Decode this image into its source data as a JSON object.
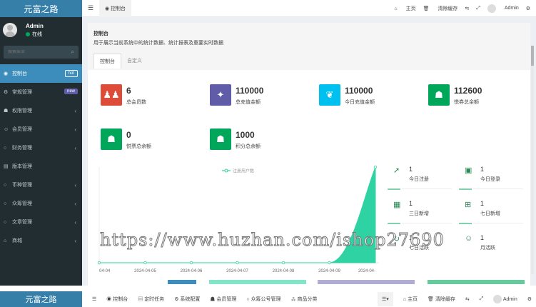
{
  "app": {
    "logo": "元富之路"
  },
  "user": {
    "name": "Admin",
    "status": "在线"
  },
  "search": {
    "placeholder": "搜索菜单"
  },
  "sidebar": {
    "items": [
      {
        "icon": "dashboard-icon",
        "glyph": "◉",
        "label": "控制台",
        "badge": "hot"
      },
      {
        "icon": "cogs-icon",
        "glyph": "⚙",
        "label": "常规管理",
        "badge": "new"
      },
      {
        "icon": "users-icon",
        "glyph": "☗",
        "label": "权限管理"
      },
      {
        "icon": "user-icon",
        "glyph": "☺",
        "label": "会员管理"
      },
      {
        "icon": "circle-icon",
        "glyph": "○",
        "label": "财务管理"
      },
      {
        "icon": "file-icon",
        "glyph": "▤",
        "label": "版本管理"
      },
      {
        "icon": "circle-icon",
        "glyph": "○",
        "label": "币种管理"
      },
      {
        "icon": "circle-icon",
        "glyph": "○",
        "label": "众筹管理"
      },
      {
        "icon": "circle-icon",
        "glyph": "○",
        "label": "文章管理"
      },
      {
        "icon": "shop-icon",
        "glyph": "⌂",
        "label": "商城"
      }
    ]
  },
  "topbar": {
    "tab": "控制台",
    "home": "主页",
    "clear_cache": "清除缓存",
    "admin": "Admin"
  },
  "panel": {
    "title": "控制台",
    "desc": "用于展示当前系统中的统计数据、统计报表及重要实时数据",
    "tabs": [
      "控制台",
      "自定义"
    ]
  },
  "stats": [
    {
      "value": "6",
      "label": "总会员数",
      "color": "#dd4b39",
      "icon": "users-icon",
      "glyph": "👥"
    },
    {
      "value": "110000",
      "label": "总充值金额",
      "color": "#605ca8",
      "icon": "magic-icon",
      "glyph": "✦"
    },
    {
      "value": "110000",
      "label": "今日充值金额",
      "color": "#00c0ef",
      "icon": "leaf-icon",
      "glyph": "❦"
    },
    {
      "value": "112600",
      "label": "悦券总余额",
      "color": "#00a65a",
      "icon": "user-icon",
      "glyph": "☗"
    },
    {
      "value": "0",
      "label": "悦票总余额",
      "color": "#00a65a",
      "icon": "user-icon",
      "glyph": "☗"
    },
    {
      "value": "1000",
      "label": "积分总余额",
      "color": "#00a65a",
      "icon": "user-icon",
      "glyph": "☗"
    }
  ],
  "right_stats": [
    {
      "value": "1",
      "label": "今日注册",
      "icon": "rocket-icon",
      "glyph": "➚"
    },
    {
      "value": "1",
      "label": "今日登录",
      "icon": "vcard-icon",
      "glyph": "▣"
    },
    {
      "value": "1",
      "label": "三日新增",
      "icon": "calendar-icon",
      "glyph": "▦"
    },
    {
      "value": "1",
      "label": "七日新增",
      "icon": "calendar-plus-icon",
      "glyph": "⊞"
    },
    {
      "value": "1",
      "label": "七日活跃",
      "icon": "refresh-icon",
      "glyph": "↻"
    },
    {
      "value": "1",
      "label": "月活跃",
      "icon": "user-circle-icon",
      "glyph": "☺"
    }
  ],
  "chart_data": {
    "type": "area",
    "legend": "注册用户数",
    "categories": [
      "04-04",
      "2024-04-05",
      "2024-04-06",
      "2024-04-07",
      "2024-04-08",
      "2024-04-09",
      "2024-04-"
    ],
    "values": [
      0,
      0,
      0,
      0,
      0,
      0,
      1
    ],
    "color": "#2fd3a3"
  },
  "watermark": "https://www.huzhan.com/ishop27690",
  "bottombar": {
    "logo": "元富之路",
    "items": [
      "控制台",
      "定时任务",
      "系统配置",
      "会员管理",
      "众筹公号管理",
      "商品分类"
    ],
    "home": "主页",
    "clear_cache": "清除缓存",
    "admin": "Admin"
  }
}
